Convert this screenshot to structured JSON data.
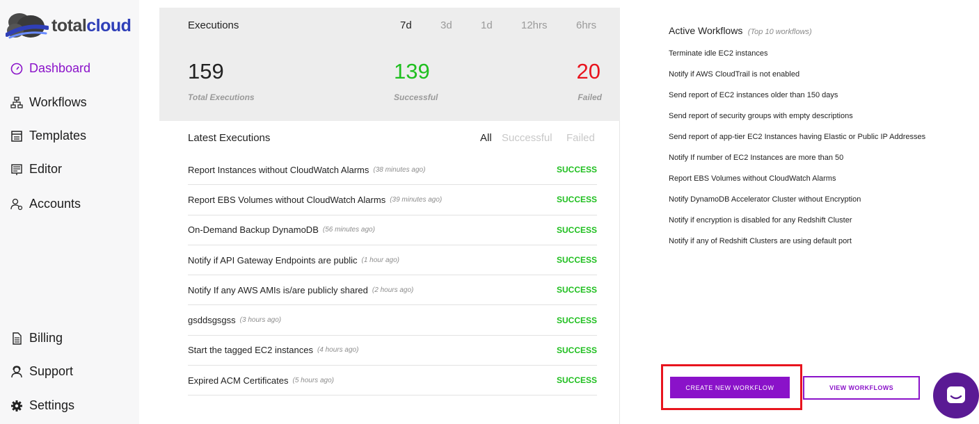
{
  "brand": {
    "part1": "total",
    "part2": "cloud"
  },
  "sidebar": {
    "items": [
      {
        "label": "Dashboard"
      },
      {
        "label": "Workflows"
      },
      {
        "label": "Templates"
      },
      {
        "label": "Editor"
      },
      {
        "label": "Accounts"
      },
      {
        "label": "Billing"
      },
      {
        "label": "Support"
      },
      {
        "label": "Settings"
      }
    ]
  },
  "executions": {
    "title": "Executions",
    "ranges": [
      "7d",
      "3d",
      "1d",
      "12hrs",
      "6hrs"
    ],
    "selected_range": "7d",
    "total": {
      "value": "159",
      "label": "Total Executions"
    },
    "successful": {
      "value": "139",
      "label": "Successful"
    },
    "failed": {
      "value": "20",
      "label": "Failed"
    }
  },
  "latest": {
    "title": "Latest Executions",
    "filters": [
      "All",
      "Successful",
      "Failed"
    ],
    "selected_filter": "All",
    "rows": [
      {
        "name": "Report Instances without CloudWatch Alarms",
        "time": "(38 minutes ago)",
        "status": "SUCCESS"
      },
      {
        "name": "Report EBS Volumes without CloudWatch Alarms",
        "time": "(39 minutes ago)",
        "status": "SUCCESS"
      },
      {
        "name": "On-Demand Backup DynamoDB",
        "time": "(56 minutes ago)",
        "status": "SUCCESS"
      },
      {
        "name": "Notify if API Gateway Endpoints are public",
        "time": "(1 hour ago)",
        "status": "SUCCESS"
      },
      {
        "name": "Notify If any AWS AMIs is/are publicly shared",
        "time": "(2 hours ago)",
        "status": "SUCCESS"
      },
      {
        "name": "gsddsgsgss",
        "time": "(3 hours ago)",
        "status": "SUCCESS"
      },
      {
        "name": "Start the tagged EC2 instances",
        "time": "(4 hours ago)",
        "status": "SUCCESS"
      },
      {
        "name": "Expired ACM Certificates",
        "time": "(5 hours ago)",
        "status": "SUCCESS"
      }
    ]
  },
  "active_workflows": {
    "title": "Active Workflows",
    "subtitle": "(Top 10 workflows)",
    "items": [
      "Terminate idle EC2 instances",
      "Notify if AWS CloudTrail is not enabled",
      "Send report of EC2 instances older than 150 days",
      "Send report of security groups with empty descriptions",
      "Send report of app-tier EC2 Instances having Elastic or Public IP Addresses",
      "Notify If number of EC2 Instances are more than 50",
      "Report EBS Volumes without CloudWatch Alarms",
      "Notify DynamoDB Accelerator Cluster without Encryption",
      "Notify if encryption is disabled for any Redshift Cluster",
      "Notify if any of Redshift Clusters are using default port"
    ]
  },
  "buttons": {
    "create": "CREATE NEW WORKFLOW",
    "view": "VIEW WORKFLOWS"
  },
  "colors": {
    "accent": "#8a12c9",
    "success": "#1fbf1f",
    "failed": "#e8141e",
    "highlight": "#e8141e"
  }
}
